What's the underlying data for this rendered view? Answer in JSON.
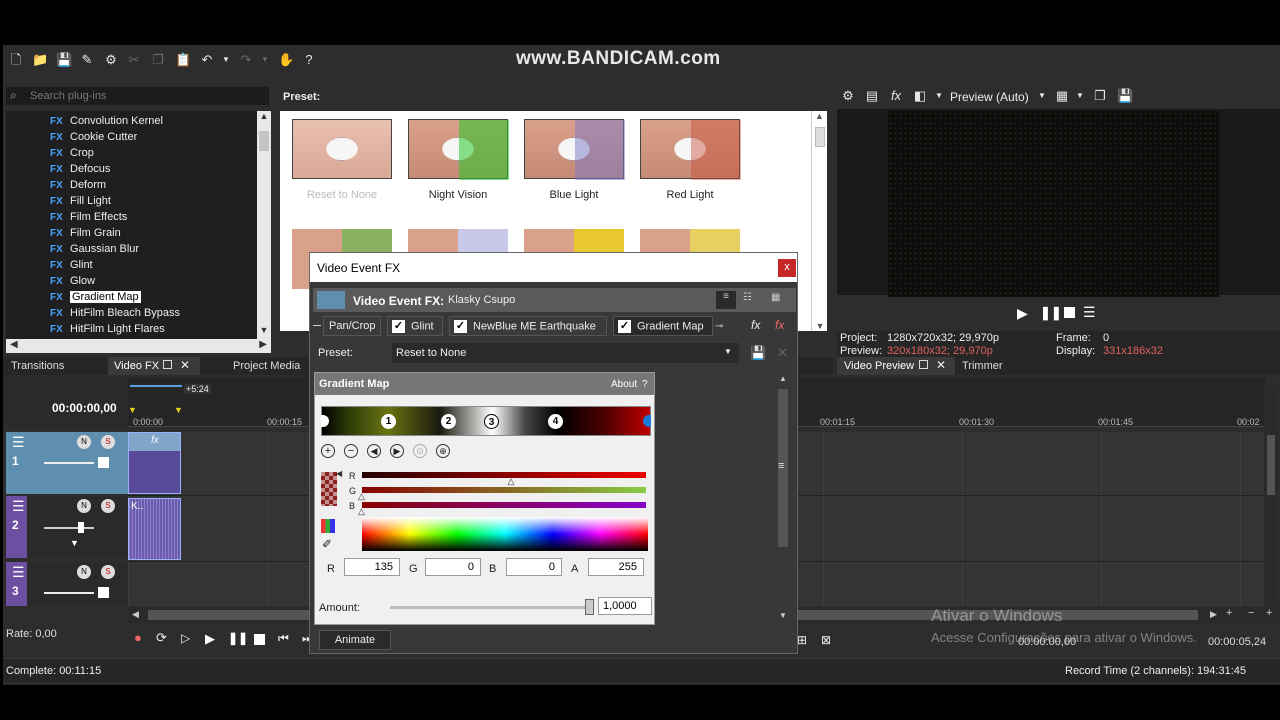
{
  "watermark": "www.BANDICAM.com",
  "plugins": {
    "search_placeholder": "Search plug-ins",
    "items": [
      "Convolution Kernel",
      "Cookie Cutter",
      "Crop",
      "Defocus",
      "Deform",
      "Fill Light",
      "Film Effects",
      "Film Grain",
      "Gaussian Blur",
      "Glint",
      "Glow",
      "Gradient Map",
      "HitFilm Bleach Bypass",
      "HitFilm Light Flares"
    ],
    "selected_index": 11,
    "fx_badge": "FX"
  },
  "preset_panel": {
    "title": "Preset:",
    "thumbs": [
      "Reset to None",
      "Night Vision",
      "Blue Light",
      "Red  Light"
    ]
  },
  "left_tabs": [
    "Transitions",
    "Video FX",
    "Project Media"
  ],
  "preview": {
    "mode": "Preview (Auto)",
    "project_label": "Project:",
    "project_value": "1280x720x32; 29,970p",
    "preview_label": "Preview:",
    "preview_value": "320x180x32; 29,970p",
    "frame_label": "Frame:",
    "frame_value": "0",
    "display_label": "Display:",
    "display_value": "331x186x32",
    "tabs": [
      "Video Preview",
      "Trimmer"
    ]
  },
  "timeline": {
    "timecode": "00:00:00,00",
    "marker_offset": "+5:24",
    "ticks": [
      "0:00:00",
      "00:00:15",
      "00:01:15",
      "00:01:30",
      "00:01:45",
      "00:02"
    ],
    "rate": "Rate: 0,00",
    "clip_label": "K..",
    "track_numbers": [
      "1",
      "2",
      "3"
    ],
    "end_time": "00:00:00,00",
    "length": "00:00:05,24"
  },
  "dialog": {
    "title": "Video Event FX",
    "close": "x",
    "header_label": "Video Event FX:",
    "header_value": "Klasky Csupo",
    "chain": [
      "Pan/Crop",
      "Glint",
      "NewBlue ME Earthquake",
      "Gradient Map"
    ],
    "preset_label": "Preset:",
    "preset_value": "Reset to None",
    "plugin_title": "Gradient Map",
    "about": "About",
    "help": "?",
    "markers": [
      "1",
      "2",
      "3",
      "4"
    ],
    "channels": {
      "r_label": "R",
      "g_label": "G",
      "b_label": "B",
      "a_label": "A",
      "r": "135",
      "g": "0",
      "b": "0",
      "a": "255"
    },
    "amount_label": "Amount:",
    "amount_value": "1,0000",
    "amount_level": 1.0,
    "animate": "Animate",
    "slider_r": 0.53,
    "slider_g": 0.0,
    "slider_b": 0.0
  },
  "status": {
    "complete": "Complete: 00:11:15",
    "record": "Record Time (2 channels): 194:31:45"
  },
  "windows_watermark": {
    "line1": "Ativar o Windows",
    "line2": "Acesse Configurações para ativar o Windows."
  },
  "colors": {
    "accent": "#1e7ad8",
    "panel": "#2d2d2d",
    "track1": "#5f8fae",
    "track2": "#6c4fa0"
  }
}
